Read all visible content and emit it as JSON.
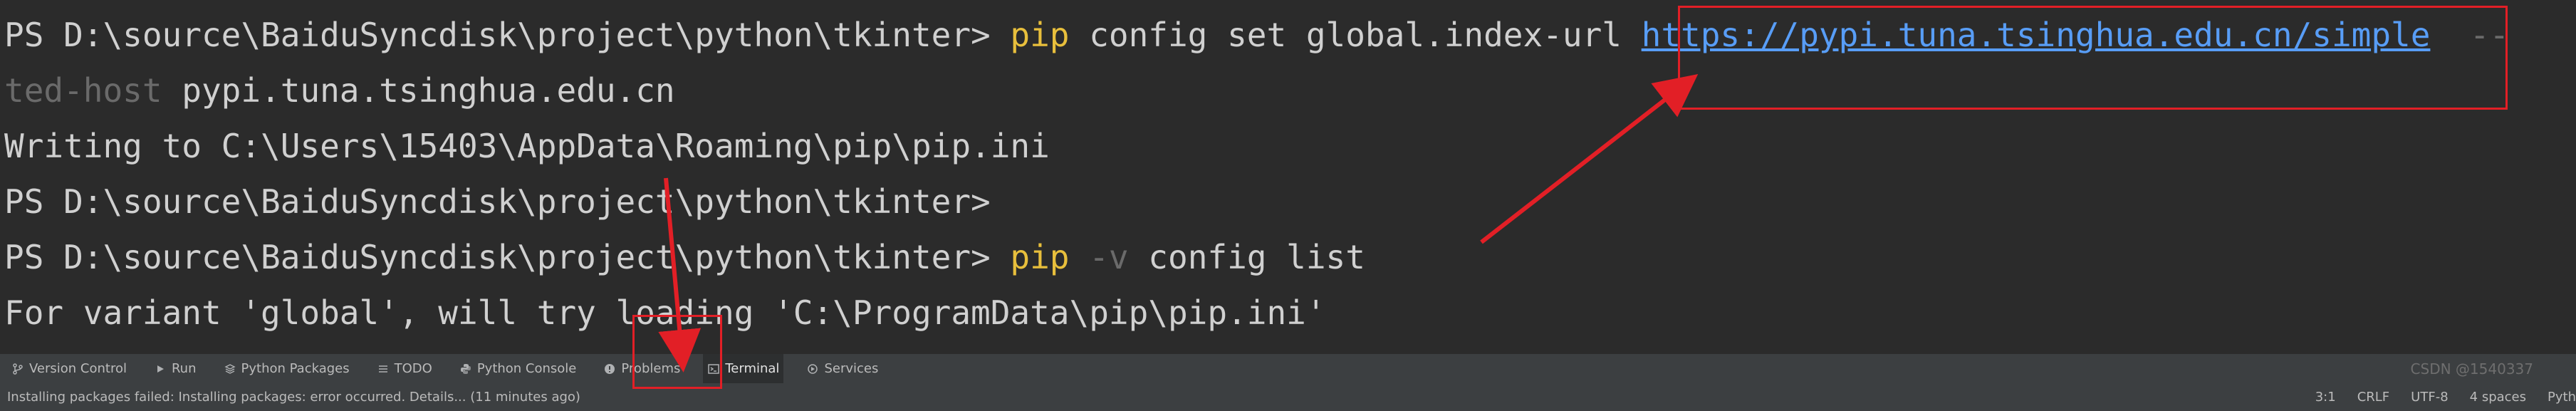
{
  "terminal": {
    "lines": [
      {
        "prompt": "PS D:\\source\\BaiduSyncdisk\\project\\python\\tkinter> ",
        "cmd": "pip",
        "rest": " config set global.index-url ",
        "url": "https://pypi.tuna.tsinghua.edu.cn/simple",
        "tail": "  --"
      },
      {
        "dim": "ted-host",
        "rest": " pypi.tuna.tsinghua.edu.cn"
      },
      {
        "text": "Writing to C:\\Users\\15403\\AppData\\Roaming\\pip\\pip.ini"
      },
      {
        "text": "PS D:\\source\\BaiduSyncdisk\\project\\python\\tkinter>"
      },
      {
        "prompt": "PS D:\\source\\BaiduSyncdisk\\project\\python\\tkinter> ",
        "cmd": "pip",
        "flag": " -v",
        "rest": " config list"
      },
      {
        "text": "For variant 'global', will try loading 'C:\\ProgramData\\pip\\pip.ini'"
      }
    ]
  },
  "toolbar": {
    "items": [
      {
        "label": "Version Control",
        "icon": "branch-icon"
      },
      {
        "label": "Run",
        "icon": "play-icon"
      },
      {
        "label": "Python Packages",
        "icon": "layers-icon"
      },
      {
        "label": "TODO",
        "icon": "list-icon"
      },
      {
        "label": "Python Console",
        "icon": "python-icon"
      },
      {
        "label": "Problems",
        "icon": "info-icon"
      },
      {
        "label": "Terminal",
        "icon": "terminal-icon"
      },
      {
        "label": "Services",
        "icon": "services-icon"
      }
    ],
    "active": "Terminal"
  },
  "status": {
    "message": "Installing packages failed: Installing packages: error occurred. Details... (11 minutes ago)",
    "position": "3:1",
    "line_separator": "CRLF",
    "encoding": "UTF-8",
    "indent": "4 spaces",
    "interpreter": "Pyth"
  },
  "watermark": "CSDN @1540337",
  "colors": {
    "background": "#2b2b2b",
    "command": "#e8bf3c",
    "link": "#589df6",
    "annotation": "#e21f26"
  }
}
